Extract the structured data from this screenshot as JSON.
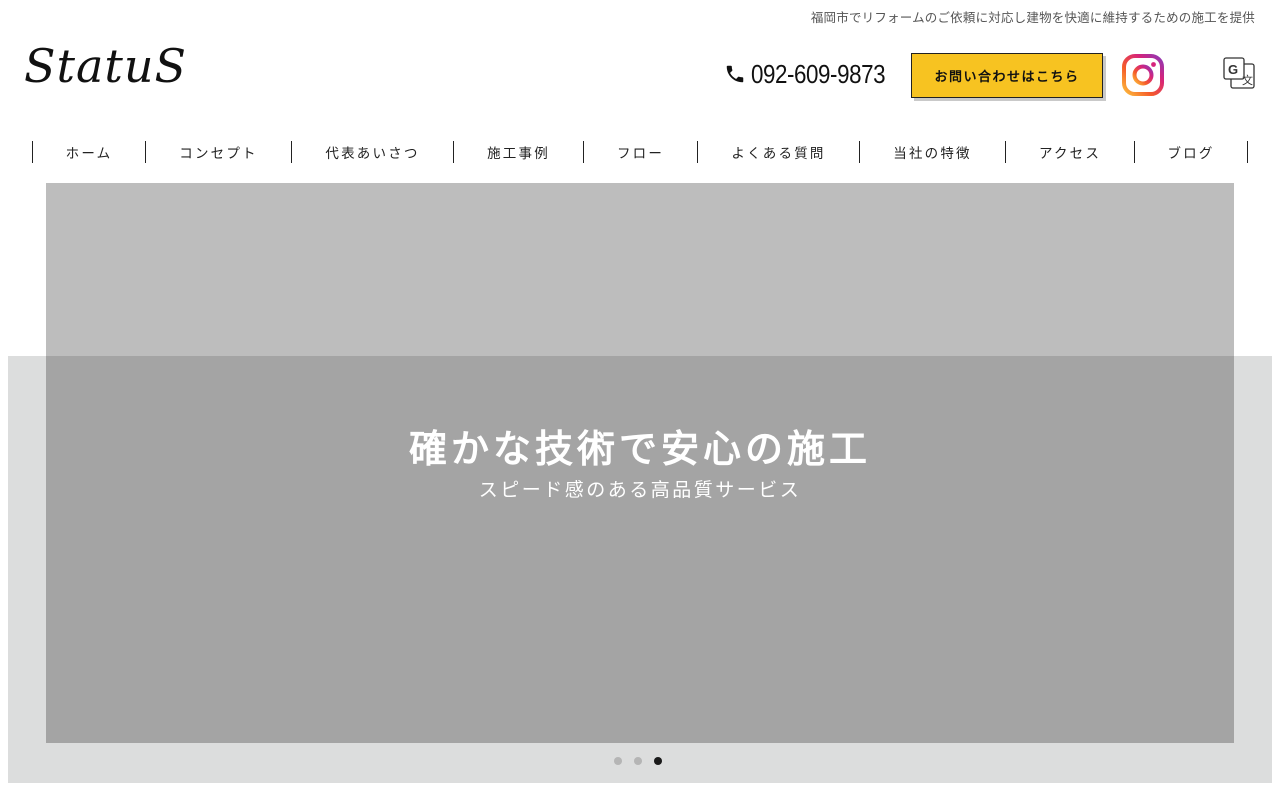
{
  "header": {
    "tagline": "福岡市でリフォームのご依頼に対応し建物を快適に維持するための施工を提供",
    "logo_text": "StatuS",
    "phone": "092-609-9873",
    "cta_label": "お問い合わせはこちら",
    "icons": {
      "phone": "phone-icon",
      "instagram": "instagram-icon",
      "translate": "google-translate-icon"
    }
  },
  "nav": {
    "items": [
      {
        "label": "ホーム"
      },
      {
        "label": "コンセプト"
      },
      {
        "label": "代表あいさつ"
      },
      {
        "label": "施工事例"
      },
      {
        "label": "フロー"
      },
      {
        "label": "よくある質問"
      },
      {
        "label": "当社の特徴"
      },
      {
        "label": "アクセス"
      },
      {
        "label": "ブログ"
      }
    ]
  },
  "hero": {
    "title": "確かな技術で安心の施工",
    "subtitle": "スピード感のある高品質サービス",
    "slide_count": 3,
    "active_slide": 3
  },
  "colors": {
    "accent": "#f7c321",
    "text": "#222222",
    "slide_bg": "#bdbdbd",
    "slide_overlay": "#a4a4a4",
    "hero_backdrop": "#dcdddd"
  }
}
